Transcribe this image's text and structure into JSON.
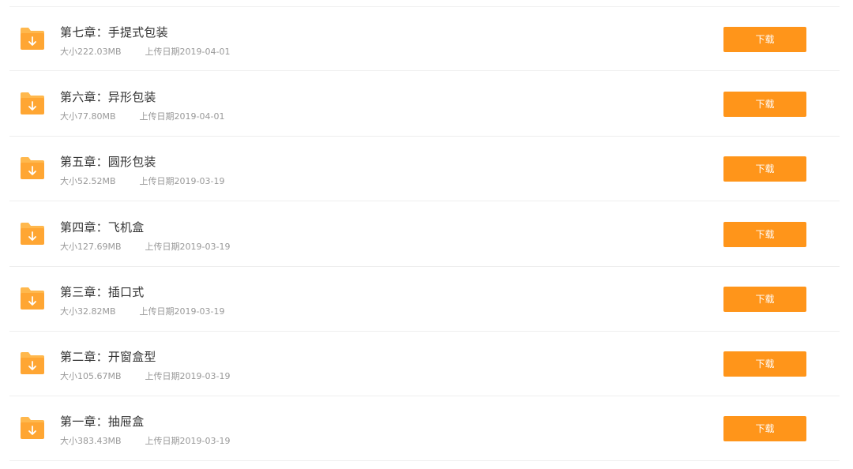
{
  "files": [
    {
      "title": "第七章：手提式包装",
      "size": "大小222.03MB",
      "date": "上传日期2019-04-01",
      "button": "下载"
    },
    {
      "title": "第六章：异形包装",
      "size": "大小77.80MB",
      "date": "上传日期2019-04-01",
      "button": "下载"
    },
    {
      "title": "第五章：圆形包装",
      "size": "大小52.52MB",
      "date": "上传日期2019-03-19",
      "button": "下载"
    },
    {
      "title": "第四章：飞机盒",
      "size": "大小127.69MB",
      "date": "上传日期2019-03-19",
      "button": "下载"
    },
    {
      "title": "第三章：插口式",
      "size": "大小32.82MB",
      "date": "上传日期2019-03-19",
      "button": "下载"
    },
    {
      "title": "第二章：开窗盒型",
      "size": "大小105.67MB",
      "date": "上传日期2019-03-19",
      "button": "下载"
    },
    {
      "title": "第一章：抽屉盒",
      "size": "大小383.43MB",
      "date": "上传日期2019-03-19",
      "button": "下载"
    }
  ],
  "icon": "folder-download-icon",
  "colors": {
    "accent": "#ff951a",
    "folder": "#ffa633",
    "folder_tab": "#ffb84d",
    "title": "#333333",
    "meta": "#999999",
    "divider": "#eeeeee"
  }
}
